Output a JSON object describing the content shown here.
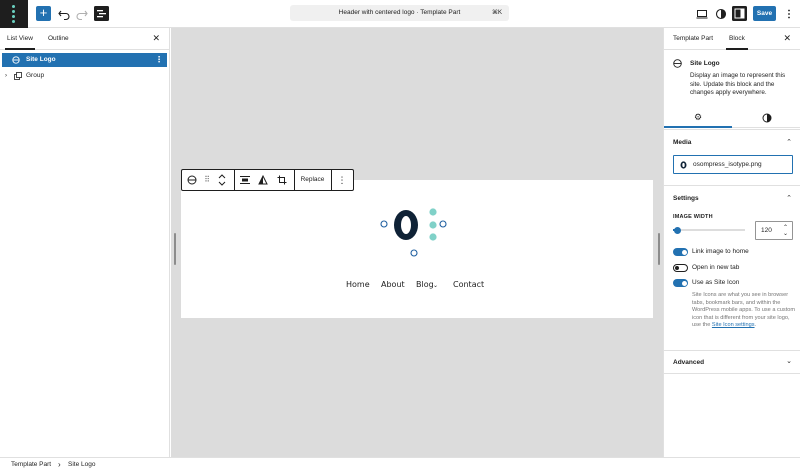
{
  "header": {
    "document_title": "Header with centered logo · Template Part",
    "shortcut": "⌘K",
    "save_label": "Save",
    "inserter_label": "+"
  },
  "list_view": {
    "tabs": [
      "List View",
      "Outline"
    ],
    "active_tab": "List View",
    "items": [
      {
        "label": "Site Logo",
        "selected": true,
        "icon": "site-logo-icon"
      },
      {
        "label": "Group",
        "selected": false,
        "icon": "group-icon"
      }
    ]
  },
  "block_toolbar": {
    "replace_label": "Replace"
  },
  "canvas": {
    "nav_items": [
      "Home",
      "About",
      "Blog",
      "Contact"
    ],
    "blog_has_submenu": true
  },
  "sidebar": {
    "tabs": [
      "Template Part",
      "Block"
    ],
    "active_tab": "Block",
    "block_title": "Site Logo",
    "block_description": "Display an image to represent this site. Update this block and the changes apply everywhere.",
    "media": {
      "title": "Media",
      "filename": "osompress_isotype.png"
    },
    "settings": {
      "title": "Settings",
      "image_width_label": "IMAGE WIDTH",
      "image_width_value": "120",
      "slider_fraction": 0.03,
      "toggles": [
        {
          "label": "Link image to home",
          "on": true
        },
        {
          "label": "Open in new tab",
          "on": false
        },
        {
          "label": "Use as Site Icon",
          "on": true
        }
      ],
      "site_icon_help": "Site Icons are what you see in browser tabs, bookmark bars, and within the WordPress mobile apps. To use a custom icon that is different from your site logo, use the",
      "site_icon_link": "Site Icon settings",
      "site_icon_end": "."
    },
    "advanced_title": "Advanced"
  },
  "breadcrumb": [
    "Template Part",
    "Site Logo"
  ],
  "colors": {
    "accent": "#2271b1",
    "logo_dark": "#0f2236",
    "logo_teal": "#80d1c8",
    "canvas_bg": "#dcdcdc"
  }
}
